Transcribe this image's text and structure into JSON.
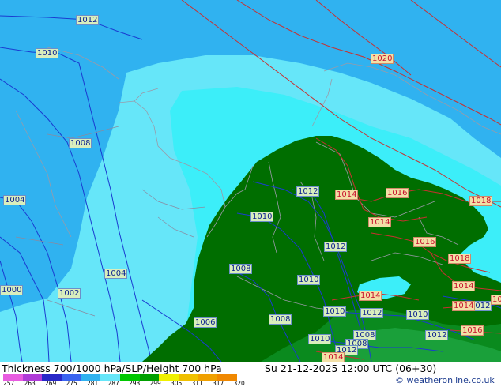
{
  "title": "Thickness 700/1000 hPa/SLP/Height 700 hPa",
  "datetime": "Su 21-12-2025 12:00 UTC (06+30)",
  "copyright": "© weatheronline.co.uk",
  "colors": {
    "sea_blue": "#30b2f0",
    "light_cyan": "#66e6f9",
    "bright_cyan": "#3ceef9",
    "land_green": "#006e00",
    "mid_green": "#0a8a1e",
    "isobar_blue": "#1a3bd0",
    "isobar_red": "#c83030"
  },
  "scale_ticks": [
    "257",
    "263",
    "269",
    "275",
    "281",
    "287",
    "293",
    "299",
    "305",
    "311",
    "317",
    "320"
  ],
  "scale_colors": [
    "#e85ce0",
    "#b03cd8",
    "#2828c8",
    "#3a64f0",
    "#30b2f0",
    "#66e6f9",
    "#00c800",
    "#00a000",
    "#f0f000",
    "#f0c000",
    "#f0a000",
    "#f08800"
  ],
  "isobar_labels": [
    {
      "text": "1012",
      "color": "blue"
    },
    {
      "text": "1010",
      "color": "blue"
    },
    {
      "text": "1008",
      "color": "blue"
    },
    {
      "text": "1004",
      "color": "blue"
    },
    {
      "text": "1004",
      "color": "blue"
    },
    {
      "text": "1002",
      "color": "blue"
    },
    {
      "text": "1000",
      "color": "blue"
    },
    {
      "text": "1006",
      "color": "blue"
    },
    {
      "text": "1008",
      "color": "blue"
    },
    {
      "text": "1008",
      "color": "blue"
    },
    {
      "text": "1010",
      "color": "blue"
    },
    {
      "text": "1012",
      "color": "blue"
    },
    {
      "text": "1012",
      "color": "blue"
    },
    {
      "text": "1010",
      "color": "blue"
    },
    {
      "text": "1010",
      "color": "blue"
    },
    {
      "text": "1012",
      "color": "blue"
    },
    {
      "text": "1010",
      "color": "blue"
    },
    {
      "text": "1010",
      "color": "blue"
    },
    {
      "text": "1008",
      "color": "blue"
    },
    {
      "text": "1008",
      "color": "blue"
    },
    {
      "text": "1012",
      "color": "blue"
    },
    {
      "text": "1012",
      "color": "blue"
    },
    {
      "text": "1012",
      "color": "blue"
    },
    {
      "text": "1020",
      "color": "red"
    },
    {
      "text": "1014",
      "color": "red"
    },
    {
      "text": "1016",
      "color": "red"
    },
    {
      "text": "1018",
      "color": "red"
    },
    {
      "text": "1014",
      "color": "red"
    },
    {
      "text": "1016",
      "color": "red"
    },
    {
      "text": "1018",
      "color": "red"
    },
    {
      "text": "1014",
      "color": "red"
    },
    {
      "text": "1014",
      "color": "red"
    },
    {
      "text": "1014",
      "color": "red"
    },
    {
      "text": "1016",
      "color": "red"
    },
    {
      "text": "1014",
      "color": "red"
    },
    {
      "text": "10",
      "color": "red"
    }
  ]
}
